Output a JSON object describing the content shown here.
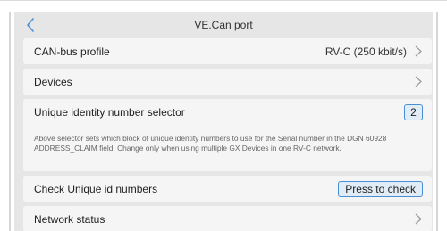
{
  "header": {
    "title": "VE.Can port"
  },
  "rows": {
    "canbus_profile": {
      "label": "CAN-bus profile",
      "value": "RV-C (250 kbit/s)"
    },
    "devices": {
      "label": "Devices"
    },
    "unique_selector": {
      "label": "Unique identity number selector",
      "value": "2",
      "description": "Above selector sets which block of unique identity numbers to use for the Serial number in the DGN 60928 ADDRESS_CLAIM field. Change only when using multiple GX Devices in one RV-C network."
    },
    "check_unique": {
      "label": "Check Unique id numbers",
      "button": "Press to check"
    },
    "network_status": {
      "label": "Network status"
    }
  },
  "colors": {
    "accent": "#4a8ed6",
    "accent_bg": "#e0ecf6",
    "screen_bg": "#e6e6e6",
    "row_bg": "#f5f5f5"
  },
  "icons": {
    "back": "chevron-left-icon",
    "row_nav": "chevron-right-icon"
  }
}
